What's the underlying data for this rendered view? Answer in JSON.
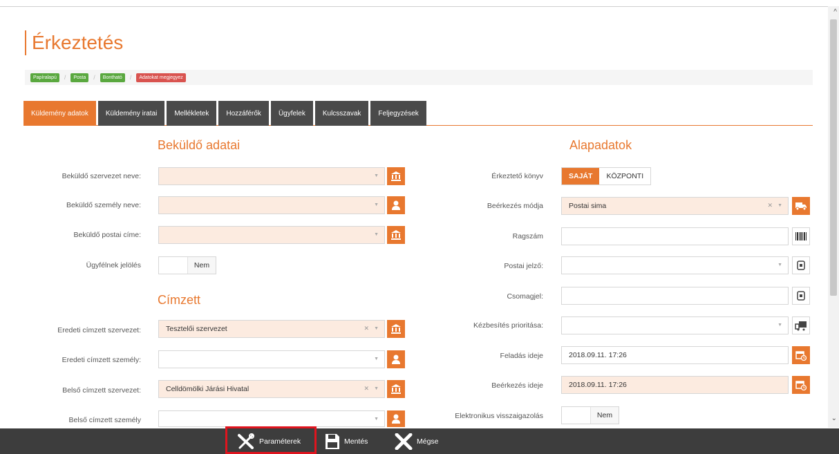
{
  "page": {
    "title": "Érkeztetés"
  },
  "breadcrumb": [
    {
      "label": "Papíralapú",
      "color": "#5aa83f"
    },
    {
      "label": "Posta",
      "color": "#5aa83f"
    },
    {
      "label": "Bontható",
      "color": "#5aa83f"
    },
    {
      "label": "Adatokat megjegyez",
      "color": "#d9534f"
    }
  ],
  "tabs": [
    {
      "label": "Küldemény adatok",
      "active": true
    },
    {
      "label": "Küldemény iratai"
    },
    {
      "label": "Mellékletek"
    },
    {
      "label": "Hozzáférők"
    },
    {
      "label": "Ügyfelek"
    },
    {
      "label": "Kulcsszavak"
    },
    {
      "label": "Feljegyzések"
    }
  ],
  "left": {
    "sender_title": "Beküldő adatai",
    "sender_org_label": "Beküldő szervezet neve:",
    "sender_person_label": "Beküldő személy neve:",
    "sender_address_label": "Beküldő postai címe:",
    "client_flag_label": "Ügyfélnek jelölés",
    "client_flag_value": "Nem",
    "recipient_title": "Címzett",
    "orig_org_label": "Eredeti címzett szervezet:",
    "orig_org_value": "Tesztelői szervezet",
    "orig_person_label": "Eredeti címzett személy:",
    "inner_org_label": "Belső címzett szervezet:",
    "inner_org_value": "Celldömölki Járási Hivatal",
    "inner_person_label": "Belső címzett személy"
  },
  "right": {
    "title": "Alapadatok",
    "book_label": "Érkeztető könyv",
    "book_own": "SAJÁT",
    "book_central": "KÖZPONTI",
    "arrival_mode_label": "Beérkezés módja",
    "arrival_mode_value": "Postai sima",
    "ragszam_label": "Ragszám",
    "postal_mark_label": "Postai jelző:",
    "package_mark_label": "Csomagjel:",
    "priority_label": "Kézbesítés prioritása:",
    "sent_time_label": "Feladás ideje",
    "sent_time_value": "2018.09.11. 17:26",
    "arrival_time_label": "Beérkezés ideje",
    "arrival_time_value": "2018.09.11. 17:26",
    "e_confirm_label": "Elektronikus visszaigazolás",
    "e_confirm_value": "Nem"
  },
  "footer": {
    "params": "Paraméterek",
    "save": "Mentés",
    "cancel": "Mégse"
  },
  "colors": {
    "accent": "#e8782f",
    "dark": "#3d3d3d",
    "highlight": "#e0141e"
  }
}
